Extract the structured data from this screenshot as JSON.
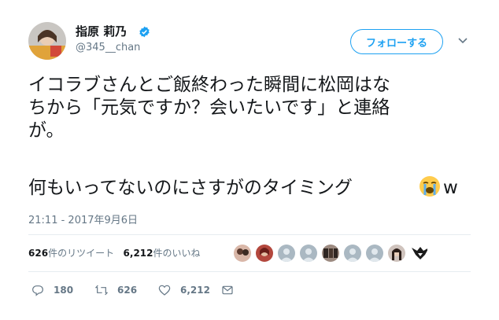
{
  "user": {
    "display_name": "指原 莉乃",
    "handle": "@345__chan",
    "verified": true
  },
  "follow_button": {
    "label": "フォローする"
  },
  "tweet": {
    "line1": "イコラブさんとご飯終わった瞬間に松岡はな",
    "line2": "ちから「元気ですか？会いたいです」と連絡",
    "line3": "が。",
    "line5": "何もいってないのにさすがのタイミング",
    "emoji": "loudly-crying-face",
    "suffix": "w"
  },
  "timestamp": "21:11 - 2017年9月6日",
  "stats": {
    "retweets_count": "626",
    "retweets_label": "件のリツイート",
    "likes_count": "6,212",
    "likes_label": "件のいいね"
  },
  "actions": {
    "reply": "180",
    "retweet": "626",
    "like": "6,212"
  },
  "colors": {
    "accent": "#1da1f2",
    "muted": "#657786",
    "divider": "#e6ecf0"
  }
}
